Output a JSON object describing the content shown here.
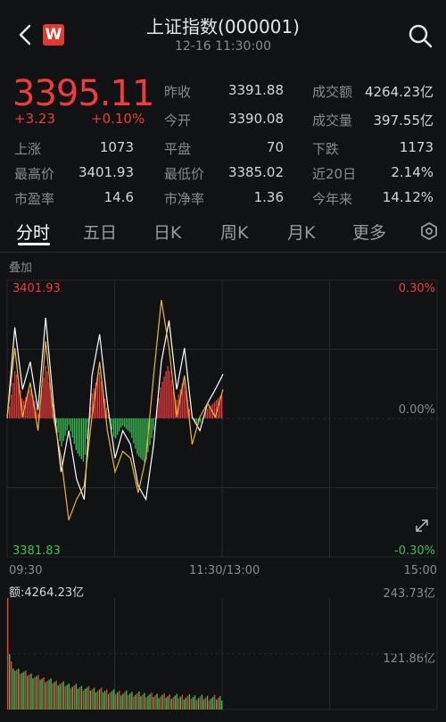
{
  "header": {
    "title": "上证指数(000001)",
    "datetime": "12-16 11:30:00",
    "logo_letter": "W"
  },
  "quote": {
    "price": "3395.11",
    "change": "+3.23",
    "change_pct": "+0.10%"
  },
  "stats": [
    {
      "label": "昨收",
      "value": "3391.88"
    },
    {
      "label": "成交额",
      "value": "4264.23亿"
    },
    {
      "label": "今开",
      "value": "3390.08"
    },
    {
      "label": "成交量",
      "value": "397.55亿"
    },
    {
      "label": "上涨",
      "value": "1073"
    },
    {
      "label": "平盘",
      "value": "70"
    },
    {
      "label": "下跌",
      "value": "1173"
    },
    {
      "label": "最高价",
      "value": "3401.93"
    },
    {
      "label": "最低价",
      "value": "3385.02"
    },
    {
      "label": "近20日",
      "value": "2.14%"
    },
    {
      "label": "市盈率",
      "value": "14.6"
    },
    {
      "label": "市净率",
      "value": "1.36"
    },
    {
      "label": "今年来",
      "value": "14.12%"
    }
  ],
  "tabs": [
    "分时",
    "五日",
    "日K",
    "周K",
    "月K",
    "更多"
  ],
  "overlay_label": "叠加",
  "chart_axes": {
    "y_top": "3401.93",
    "y_bottom": "3381.83",
    "pct_top": "0.30%",
    "pct_mid": "0.00%",
    "pct_bottom": "-0.30%",
    "x_left": "09:30",
    "x_mid": "11:30/13:00",
    "x_right": "15:00"
  },
  "volume": {
    "label": "额:4264.23亿",
    "max": "243.73亿",
    "mid": "121.86亿"
  },
  "colors": {
    "up": "#ef3b3b",
    "down": "#39c054",
    "line_white": "#ffffff",
    "line_yellow": "#e8b73a",
    "background": "#111214"
  },
  "chart_data": {
    "type": "line",
    "price_range": [
      3381.83,
      3401.93
    ],
    "pct_range": [
      -0.3,
      0.3
    ],
    "series": [
      {
        "values": [
          3391.9,
          3398.5,
          3394.0,
          3396.0,
          3392.5,
          3399.2,
          3393.0,
          3388.0,
          3391.0,
          3387.5,
          3386.0,
          3395.0,
          3398.0,
          3393.0,
          3389.0,
          3391.0,
          3390.0,
          3387.0,
          3386.0,
          3390.0,
          3396.0,
          3399.0,
          3394.0,
          3397.0,
          3392.0,
          3391.0,
          3393.0,
          3394.0,
          3395.1
        ]
      },
      {
        "values": [
          3391.9,
          3397.0,
          3392.0,
          3394.5,
          3391.0,
          3397.5,
          3392.0,
          3389.0,
          3384.5,
          3386.0,
          3387.0,
          3392.0,
          3396.0,
          3391.0,
          3388.0,
          3389.5,
          3389.0,
          3386.5,
          3389.0,
          3395.0,
          3400.5,
          3397.0,
          3392.0,
          3395.0,
          3390.0,
          3392.0,
          3393.0,
          3392.0,
          3394.0
        ]
      }
    ]
  }
}
